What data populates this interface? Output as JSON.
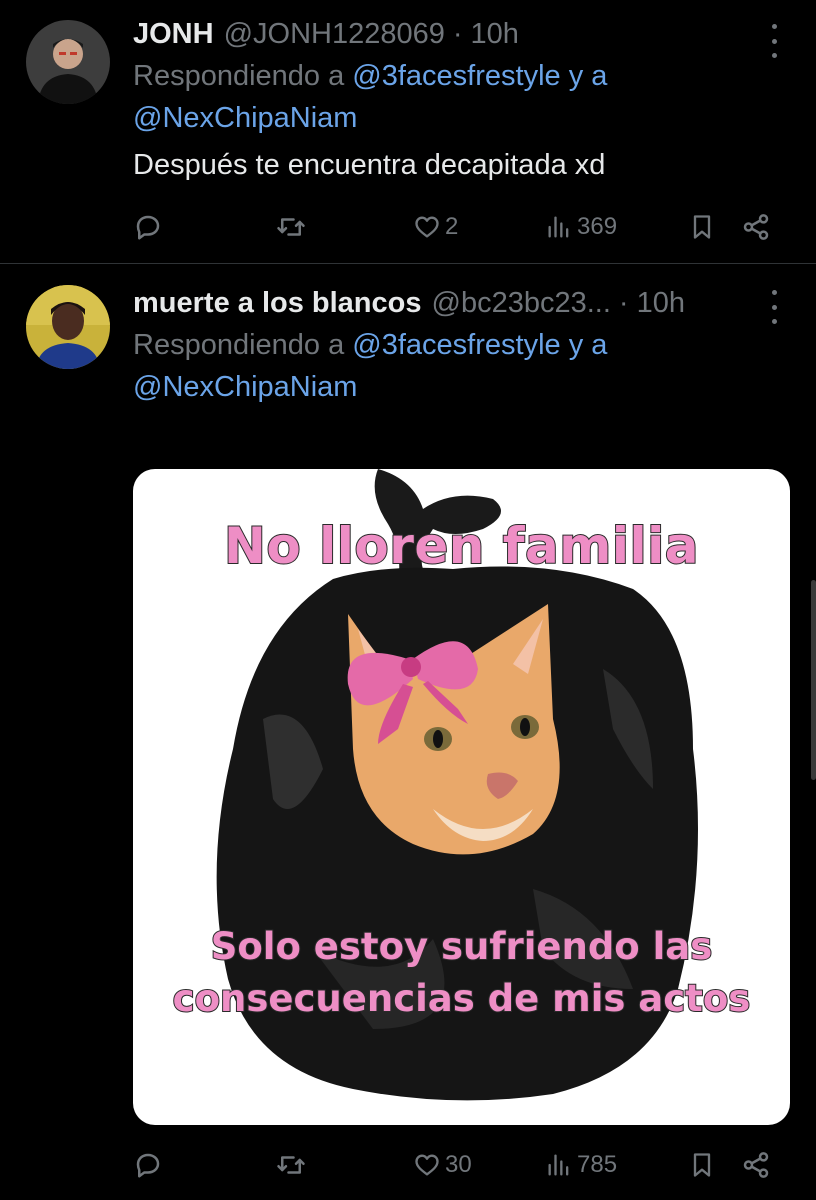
{
  "posts": [
    {
      "name": "JONH",
      "handle": "@JONH1228069",
      "separator": "·",
      "time": "10h",
      "reply_prefix": "Respondiendo a",
      "mention_1": "@3facesfrestyle",
      "reply_and": "y a",
      "mention_2": "@NexChipaNiam",
      "text": "Después te encuentra decapitada xd",
      "replies": "",
      "retweets": "",
      "likes": "2",
      "views": "369"
    },
    {
      "name": "muerte a los blancos",
      "handle": "@bc23bc23...",
      "separator": "·",
      "time": "10h",
      "reply_prefix": "Respondiendo a",
      "mention_1": "@3facesfrestyle",
      "reply_and": "y a",
      "mention_2": "@NexChipaNiam",
      "media": {
        "top_text": "No lloren familia",
        "bottom_text": "Solo estoy sufriendo las consecuencias de mis actos"
      },
      "replies": "",
      "retweets": "",
      "likes": "30",
      "views": "785"
    }
  ],
  "colors": {
    "background": "#000000",
    "text_primary": "#e7e9ea",
    "text_secondary": "#71767b",
    "mention": "#6ba4e8",
    "meme_text": "#ee8ec5"
  },
  "icons": [
    "reply-icon",
    "retweet-icon",
    "like-icon",
    "views-icon",
    "bookmark-icon",
    "share-icon",
    "more-icon"
  ]
}
